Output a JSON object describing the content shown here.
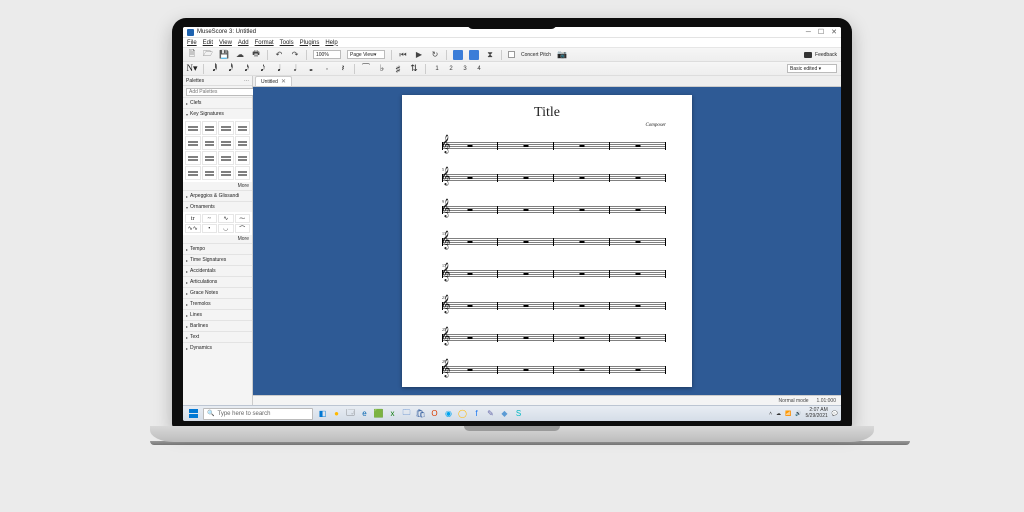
{
  "window": {
    "title": "MuseScore 3: Untitled"
  },
  "menu": [
    "File",
    "Edit",
    "View",
    "Add",
    "Format",
    "Tools",
    "Plugins",
    "Help"
  ],
  "toolbar": {
    "zoom": "100%",
    "view": "Page View",
    "concert_pitch": "Concert Pitch",
    "feedback": "Feedback",
    "row2_end": "Basic edited ▾",
    "numbers": [
      "1",
      "2",
      "3",
      "4"
    ]
  },
  "palettes": {
    "title": "Palettes",
    "add": "Add Palettes",
    "more": "More",
    "sections": [
      "Clefs",
      "Key Signatures",
      "Arpeggios & Glissandi",
      "Ornaments",
      "Tempo",
      "Time Signatures",
      "Accidentals",
      "Articulations",
      "Grace Notes",
      "Tremolos",
      "Lines",
      "Barlines",
      "Text",
      "Dynamics"
    ],
    "ornaments": [
      "tr",
      "~",
      "∿",
      "⁓",
      "∿∿",
      "•",
      "◡",
      "⌒"
    ]
  },
  "tabs": {
    "doc": "Untitled"
  },
  "score": {
    "title": "Title",
    "composer": "Composer",
    "systems": [
      1,
      5,
      9,
      13,
      17,
      21,
      25,
      29
    ]
  },
  "status": {
    "mode": "Normal mode",
    "ratio": "1.01:000"
  },
  "taskbar": {
    "search_placeholder": "Type here to search",
    "time": "2:07 AM",
    "date": "5/29/2021",
    "apps": [
      {
        "c": "#0078d4",
        "g": "◧"
      },
      {
        "c": "#ffb900",
        "g": "●"
      },
      {
        "c": "#333",
        "g": "🗔"
      },
      {
        "c": "#0063b1",
        "g": "e"
      },
      {
        "c": "#0f7b0f",
        "g": "🟩"
      },
      {
        "c": "#107c10",
        "g": "x"
      },
      {
        "c": "#185abd",
        "g": "🗀"
      },
      {
        "c": "#2b579a",
        "g": "🛍"
      },
      {
        "c": "#d83b01",
        "g": "O"
      },
      {
        "c": "#00a4ef",
        "g": "◉"
      },
      {
        "c": "#ffb900",
        "g": "◯"
      },
      {
        "c": "#1877f2",
        "g": "f"
      },
      {
        "c": "#6264a7",
        "g": "✎"
      },
      {
        "c": "#5b9bd5",
        "g": "◆"
      },
      {
        "c": "#00b7c3",
        "g": "S"
      }
    ]
  }
}
